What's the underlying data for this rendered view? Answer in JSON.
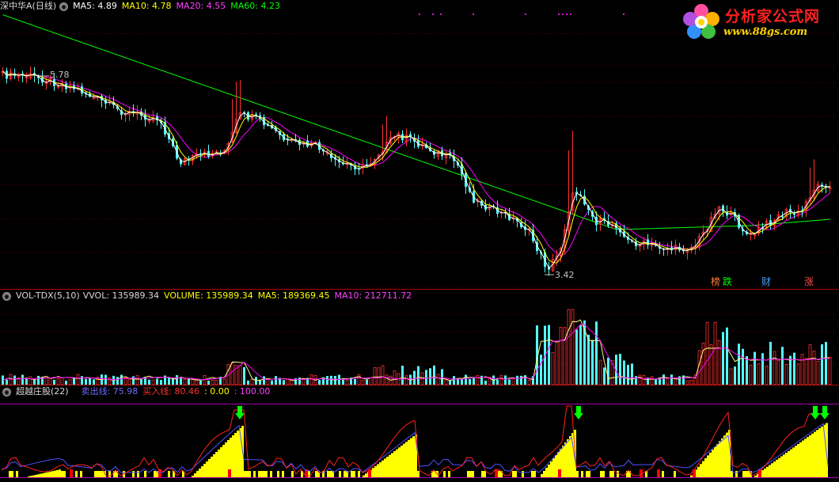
{
  "price_panel": {
    "stock_name": "深中华A(日线)",
    "ma5_label": "MA5: 4.89",
    "ma10_label": "MA10: 4.78",
    "ma20_label": "MA20: 4.55",
    "ma60_label": "MA60: 4.23",
    "high_label": "5.78",
    "low_label": "3.42",
    "events": [
      "榜",
      "跌",
      "财",
      "涨"
    ]
  },
  "volume_panel": {
    "indicator_name": "VOL-TDX(5,10)",
    "vvol_label": "VVOL: 135989.34",
    "volume_label": "VOLUME: 135989.34",
    "ma5_label": "MA5: 189369.45",
    "ma10_label": "MA10: 212711.72"
  },
  "indicator_panel": {
    "name": "超越庄股(22)",
    "sell_label": "卖出线: 75.98",
    "buy_label": "买入线: 80.46",
    "level0_label": ": 0.00",
    "level100_label": ": 100.00"
  },
  "logo": {
    "text": "分析家公式网",
    "url": "www.88gs.com"
  },
  "colors": {
    "up": "#ff3232",
    "down": "#54fcfc",
    "ma5": "#ffffff",
    "ma10": "#ffff00",
    "ma20": "#ff00ff",
    "ma60": "#00ff00",
    "sell_line": "#5050ff",
    "buy_line": "#ff2020",
    "bar_signal": "#ffff00",
    "red_signal": "#ff0000",
    "arrow": "#00ff00"
  }
}
